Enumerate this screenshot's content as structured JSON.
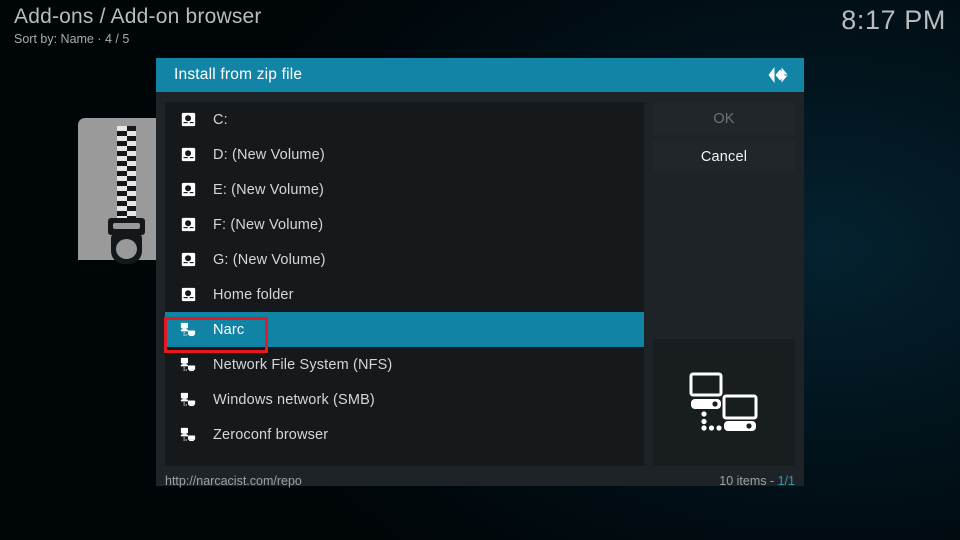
{
  "header": {
    "title": "Add-ons / Add-on browser",
    "subtitle": "Sort by: Name  ·  4 / 5",
    "clock": "8:17 PM"
  },
  "dialog": {
    "title": "Install from zip file",
    "logo_icon": "kodi-logo-icon",
    "buttons": {
      "ok_label": "OK",
      "ok_enabled": false,
      "cancel_label": "Cancel",
      "cancel_enabled": true
    },
    "preview_icon": "network-computers-icon",
    "footer": {
      "path": "http://narcacist.com/repo",
      "count": "10 items - ",
      "page": "1/1"
    },
    "items": [
      {
        "label": "C:",
        "icon": "hard-disk-icon",
        "selected": false
      },
      {
        "label": "D: (New Volume)",
        "icon": "hard-disk-icon",
        "selected": false
      },
      {
        "label": "E: (New Volume)",
        "icon": "hard-disk-icon",
        "selected": false
      },
      {
        "label": "F: (New Volume)",
        "icon": "hard-disk-icon",
        "selected": false
      },
      {
        "label": "G: (New Volume)",
        "icon": "hard-disk-icon",
        "selected": false
      },
      {
        "label": "Home folder",
        "icon": "hard-disk-icon",
        "selected": false
      },
      {
        "label": "Narc",
        "icon": "network-icon",
        "selected": true
      },
      {
        "label": "Network File System (NFS)",
        "icon": "network-icon",
        "selected": false
      },
      {
        "label": "Windows network (SMB)",
        "icon": "network-icon",
        "selected": false
      },
      {
        "label": "Zeroconf browser",
        "icon": "network-icon",
        "selected": false
      }
    ]
  },
  "background": {
    "artwork_icon": "zip-file-icon"
  },
  "annotation": {
    "highlight_color": "#e8191e",
    "target": "Narc"
  },
  "colors": {
    "accent_teal": "#1184a5",
    "titlebar_teal": "#1285a6",
    "dialog_bg": "#1d2326",
    "list_bg": "#15191b",
    "text": "#d4d6d8"
  }
}
